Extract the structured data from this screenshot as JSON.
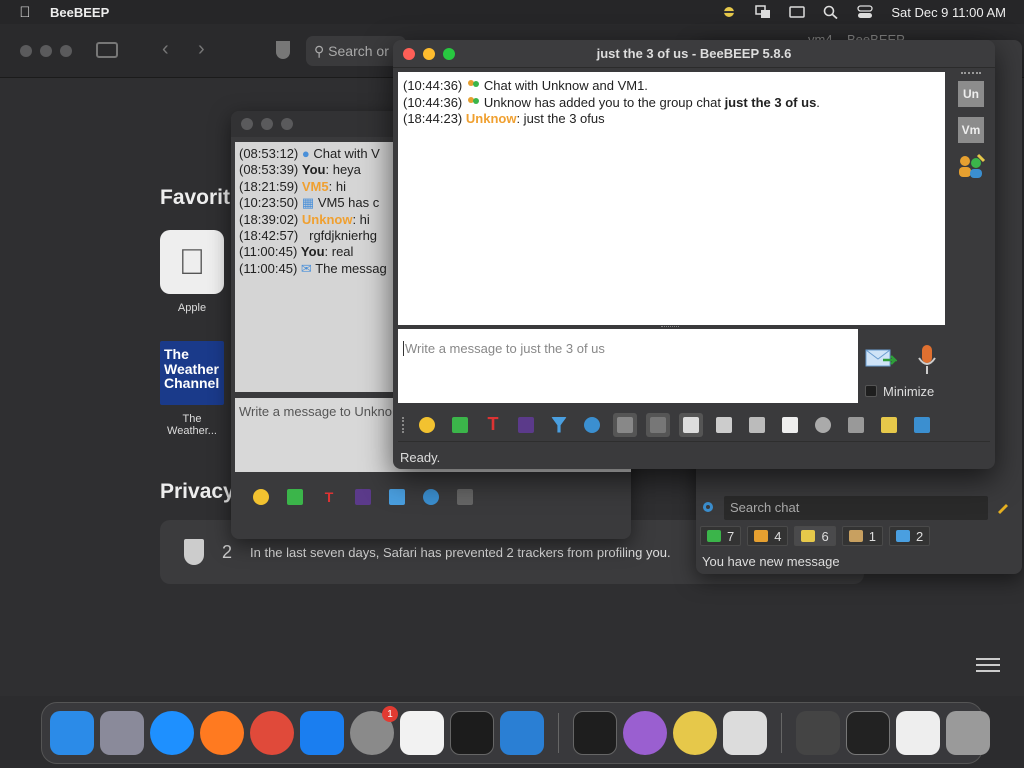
{
  "menubar": {
    "app_name": "BeeBEEP",
    "clock": "Sat Dec 9  11:00 AM"
  },
  "safari": {
    "search_placeholder": "Search or",
    "background_window_title": "vm4 – BeeBEEP",
    "favorites_title": "Favorit",
    "favorites": [
      {
        "label": "Apple"
      },
      {
        "label": "The Weather...",
        "tile_text": "The Weather Channel"
      }
    ],
    "privacy_title": "Privacy",
    "privacy_count": "2",
    "privacy_text": "In the last seven days, Safari has prevented 2 trackers from profiling you."
  },
  "background_chat": {
    "messages": [
      {
        "time": "(08:53:12)",
        "text": "Chat with V"
      },
      {
        "time": "(08:53:39)",
        "sender": "You",
        "text": ": heya"
      },
      {
        "time": "(18:21:59)",
        "sender": "VM5",
        "text": ": hi"
      },
      {
        "time": "(10:23:50)",
        "text": "VM5 has c"
      },
      {
        "time": "(18:39:02)",
        "sender": "Unknow",
        "text": ": hi"
      },
      {
        "time": "(18:42:57)",
        "text": "rgfdjknierhg"
      },
      {
        "time": "(11:00:45)",
        "sender": "You",
        "text": ": real"
      },
      {
        "time": "(11:00:45)",
        "text": "The messag"
      }
    ],
    "compose_placeholder": "Write a message to Unkno"
  },
  "main_window": {
    "title": "just the 3 of us - BeeBEEP 5.8.6",
    "messages": [
      {
        "time": "(10:44:36)",
        "pre": "Chat with Unknow and VM1.",
        "bold": "",
        "post": ""
      },
      {
        "time": "(10:44:36)",
        "pre": "Unknow has added you to the group chat ",
        "bold": "just the 3 of us",
        "post": "."
      },
      {
        "time": "(18:44:23)",
        "sender": "Unknow",
        "post": ": just the 3 ofus"
      }
    ],
    "compose_placeholder": "Write a message to just the 3 of us",
    "minimize_label": "Minimize",
    "members": [
      "Un",
      "Vm"
    ],
    "status": "Ready."
  },
  "list_window": {
    "search_placeholder": "Search chat",
    "counts": [
      "7",
      "4",
      "6",
      "1",
      "2"
    ],
    "new_message_text": "You have new message"
  },
  "dock": {
    "settings_badge": "1"
  },
  "colors": {
    "unknow_orange": "#f0a030",
    "vm5_orange": "#f0a030",
    "accent_green": "#28c840"
  }
}
